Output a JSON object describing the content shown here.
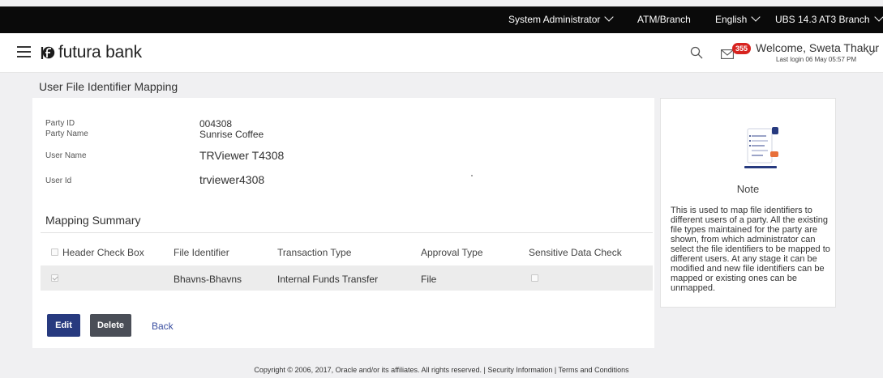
{
  "topbar": {
    "role": "System Administrator",
    "entity": "ATM/Branch",
    "language": "English",
    "branch": "UBS 14.3 AT3 Branch"
  },
  "header": {
    "logo_text": "futura bank",
    "notification_count": "355",
    "welcome": "Welcome, Sweta Thakur",
    "last_login": "Last login 06 May 05:57 PM",
    "icons": [
      "menu-icon",
      "search-icon",
      "mail-icon",
      "chevron-down-icon"
    ]
  },
  "page": {
    "title": "User File Identifier Mapping"
  },
  "details": {
    "party_id_label": "Party ID",
    "party_id": "004308",
    "party_name_label": "Party Name",
    "party_name": "Sunrise Coffee",
    "user_name_label": "User Name",
    "user_name": "TRViewer T4308",
    "user_id_label": "User Id",
    "user_id": "trviewer4308"
  },
  "summary": {
    "title": "Mapping Summary",
    "columns": [
      "Header Check Box",
      "File Identifier",
      "Transaction Type",
      "Approval Type",
      "Sensitive Data Check"
    ],
    "rows": [
      {
        "selected": true,
        "file_identifier": "Bhavns-Bhavns",
        "transaction_type": "Internal Funds Transfer",
        "approval_type": "File",
        "sensitive_data_check": false
      }
    ]
  },
  "actions": {
    "edit": "Edit",
    "delete": "Delete",
    "back": "Back"
  },
  "note": {
    "title": "Note",
    "text": "This is used to map file identifiers to different users of a party. All the existing file types maintained for the party are shown, from which administrator can select the file identifiers to be mapped to different users. At any stage it can be modified and new file identifiers can be mapped or existing ones can be unmapped."
  },
  "footer": {
    "text": "Copyright © 2006, 2017, Oracle and/or its affiliates. All rights reserved. | Security Information | Terms and Conditions"
  },
  "colors": {
    "topbar_bg": "#0a0a0a",
    "primary_button": "#273a7f",
    "secondary_button": "#4a4e57",
    "badge": "#d7231f",
    "page_bg": "#f0f0f2"
  }
}
